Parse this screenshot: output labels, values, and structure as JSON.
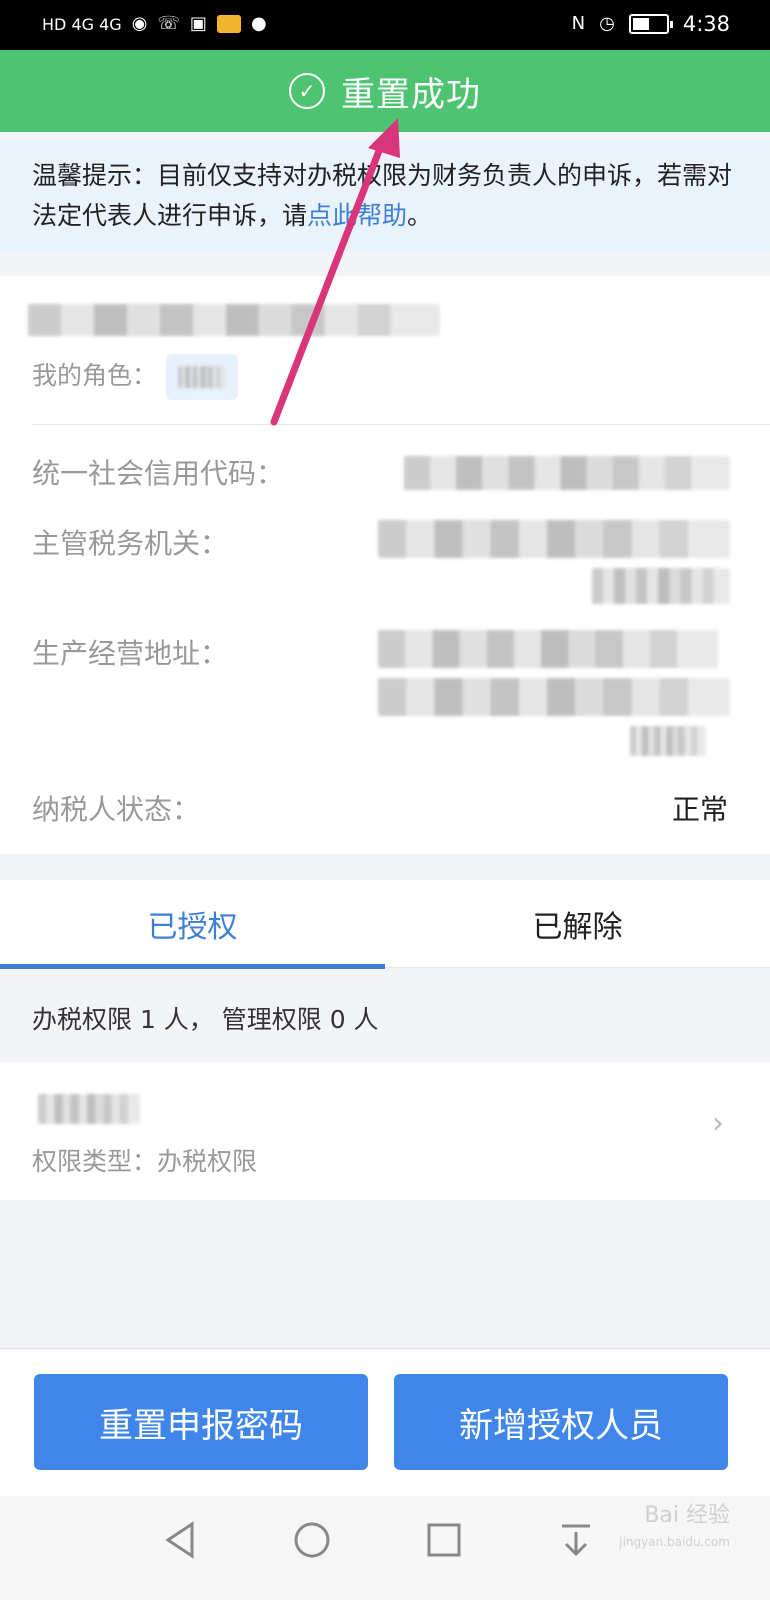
{
  "status_bar": {
    "left_text": "HD 4G 4G",
    "time": "4:38"
  },
  "toast": {
    "text": "重置成功",
    "icon": "check-circle-icon",
    "color": "#4ec472"
  },
  "notice": {
    "text": "温馨提示：目前仅支持对办税权限为财务负责人的申诉，若需对法定代表人进行申诉，请",
    "link": "点此帮助",
    "suffix": "。"
  },
  "company": {
    "role_label": "我的角色："
  },
  "details": {
    "credit_code_label": "统一社会信用代码：",
    "tax_authority_label": "主管税务机关：",
    "address_label": "生产经营地址：",
    "status_label": "纳税人状态：",
    "status_value": "正常"
  },
  "tabs": {
    "authorized": "已授权",
    "removed": "已解除"
  },
  "summary": "办税权限 1 人， 管理权限 0 人",
  "list": [
    {
      "sub_label": "权限类型：办税权限"
    }
  ],
  "buttons": {
    "reset_password": "重置申报密码",
    "add_person": "新增授权人员"
  },
  "watermark": {
    "text": "Bai 经验",
    "sub": "jingyan.baidu.com"
  },
  "colors": {
    "accent": "#3d7fd6",
    "button": "#3f86e8",
    "success": "#4ec472",
    "arrow": "#d9357a"
  }
}
